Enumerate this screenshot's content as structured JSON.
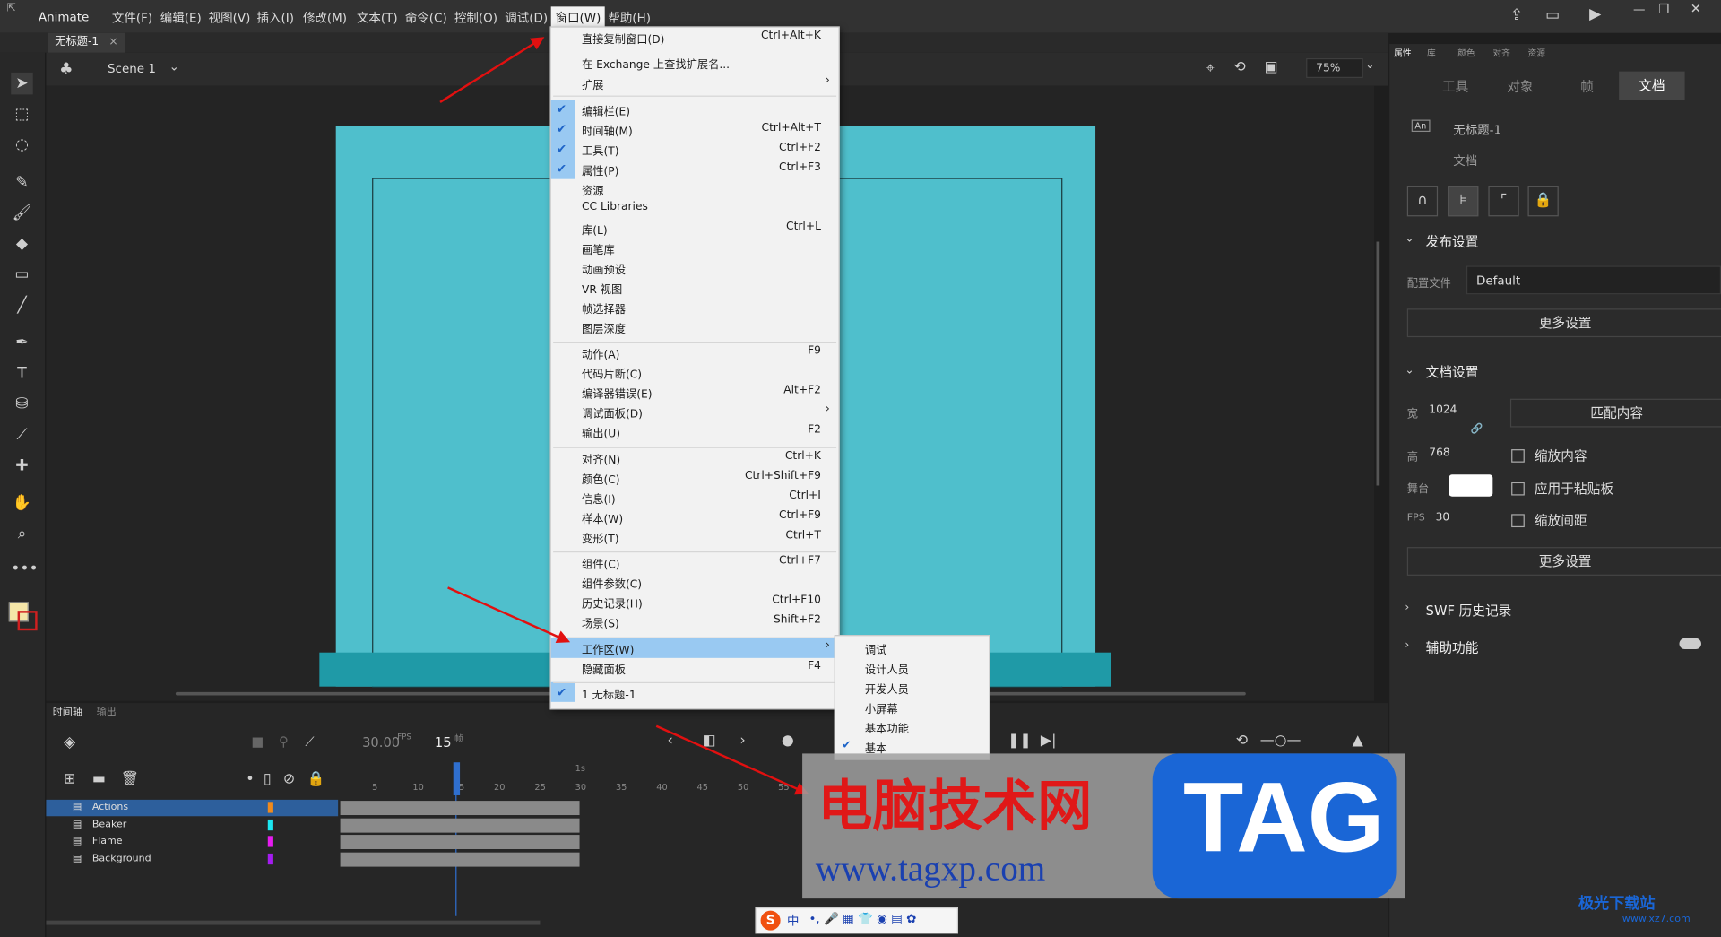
{
  "app": {
    "name": "Animate"
  },
  "menubar": {
    "items": [
      "文件(F)",
      "编辑(E)",
      "视图(V)",
      "插入(I)",
      "修改(M)",
      "文本(T)",
      "命令(C)",
      "控制(O)",
      "调试(D)",
      "窗口(W)",
      "帮助(H)"
    ]
  },
  "doc_tab": {
    "title": "无标题-1",
    "close": "×"
  },
  "scene": {
    "label": "Scene 1",
    "zoom": "75%"
  },
  "window_menu": {
    "items": [
      {
        "label": "直接复制窗口(D)",
        "shortcut": "Ctrl+Alt+K",
        "checked": false
      },
      {
        "label": "在 Exchange 上查找扩展名...",
        "shortcut": "",
        "checked": false
      },
      {
        "label": "扩展",
        "shortcut": "›",
        "checked": false
      },
      {
        "label": "编辑栏(E)",
        "shortcut": "",
        "checked": true
      },
      {
        "label": "时间轴(M)",
        "shortcut": "Ctrl+Alt+T",
        "checked": true
      },
      {
        "label": "工具(T)",
        "shortcut": "Ctrl+F2",
        "checked": true
      },
      {
        "label": "属性(P)",
        "shortcut": "Ctrl+F3",
        "checked": true
      },
      {
        "label": "资源",
        "shortcut": "",
        "checked": false
      },
      {
        "label": "CC Libraries",
        "shortcut": "",
        "checked": false
      },
      {
        "label": "库(L)",
        "shortcut": "Ctrl+L",
        "checked": false
      },
      {
        "label": "画笔库",
        "shortcut": "",
        "checked": false
      },
      {
        "label": "动画预设",
        "shortcut": "",
        "checked": false
      },
      {
        "label": "VR 视图",
        "shortcut": "",
        "checked": false
      },
      {
        "label": "帧选择器",
        "shortcut": "",
        "checked": false
      },
      {
        "label": "图层深度",
        "shortcut": "",
        "checked": false
      },
      {
        "label": "动作(A)",
        "shortcut": "F9",
        "checked": false
      },
      {
        "label": "代码片断(C)",
        "shortcut": "",
        "checked": false
      },
      {
        "label": "编译器错误(E)",
        "shortcut": "Alt+F2",
        "checked": false
      },
      {
        "label": "调试面板(D)",
        "shortcut": "›",
        "checked": false
      },
      {
        "label": "输出(U)",
        "shortcut": "F2",
        "checked": false
      },
      {
        "label": "对齐(N)",
        "shortcut": "Ctrl+K",
        "checked": false
      },
      {
        "label": "颜色(C)",
        "shortcut": "Ctrl+Shift+F9",
        "checked": false
      },
      {
        "label": "信息(I)",
        "shortcut": "Ctrl+I",
        "checked": false
      },
      {
        "label": "样本(W)",
        "shortcut": "Ctrl+F9",
        "checked": false
      },
      {
        "label": "变形(T)",
        "shortcut": "Ctrl+T",
        "checked": false
      },
      {
        "label": "组件(C)",
        "shortcut": "Ctrl+F7",
        "checked": false
      },
      {
        "label": "组件参数(C)",
        "shortcut": "",
        "checked": false
      },
      {
        "label": "历史记录(H)",
        "shortcut": "Ctrl+F10",
        "checked": false
      },
      {
        "label": "场景(S)",
        "shortcut": "Shift+F2",
        "checked": false
      },
      {
        "label": "工作区(W)",
        "shortcut": "›",
        "checked": false
      },
      {
        "label": "隐藏面板",
        "shortcut": "F4",
        "checked": false
      },
      {
        "label": "1 无标题-1",
        "shortcut": "",
        "checked": true
      }
    ]
  },
  "workspace_submenu": {
    "items": [
      {
        "label": "调试",
        "checked": false
      },
      {
        "label": "设计人员",
        "checked": false
      },
      {
        "label": "开发人员",
        "checked": false
      },
      {
        "label": "小屏幕",
        "checked": false
      },
      {
        "label": "基本功能",
        "checked": false
      },
      {
        "label": "基本",
        "checked": true
      }
    ]
  },
  "timeline": {
    "tabs": [
      "时间轴",
      "输出"
    ],
    "fps": "30.00",
    "fps_unit": "FPS",
    "frame": "15",
    "frame_unit": "帧",
    "ruler": [
      "5",
      "10",
      "15",
      "20",
      "25",
      "30",
      "35",
      "40",
      "45",
      "50",
      "55"
    ],
    "second_marker": "1s",
    "layers": [
      {
        "name": "Actions",
        "color": "#f08a1c"
      },
      {
        "name": "Beaker",
        "color": "#1ce6f0"
      },
      {
        "name": "Flame",
        "color": "#e61cf0"
      },
      {
        "name": "Background",
        "color": "#a51cf0"
      }
    ]
  },
  "properties": {
    "top_tabs": [
      "属性",
      "库",
      "颜色",
      "对齐",
      "资源"
    ],
    "sub_tabs": [
      "工具",
      "对象",
      "帧",
      "文档"
    ],
    "doc_name": "无标题-1",
    "doc_type": "文档",
    "publish_header": "发布设置",
    "profile_label": "配置文件",
    "profile_value": "Default",
    "more_settings": "更多设置",
    "doc_settings_header": "文档设置",
    "width_label": "宽",
    "width": "1024",
    "height_label": "高",
    "height": "768",
    "match_content": "匹配内容",
    "stage_label": "舞台",
    "stage_color": "#ffffff",
    "fps_label": "FPS",
    "fps": "30",
    "scale_content": "缩放内容",
    "apply_paste": "应用于粘贴板",
    "scale_spacing": "缩放间距",
    "more_settings2": "更多设置",
    "swf_history": "SWF 历史记录",
    "accessibility": "辅助功能"
  },
  "watermark": {
    "title": "电脑技术网",
    "url": "www.tagxp.com",
    "logo": "TAG"
  },
  "corner_watermark": {
    "site": "极光下载站",
    "url": "www.xz7.com"
  },
  "ime_bar": {
    "label": "中"
  },
  "colors": {
    "stage": "#4fbfcc",
    "accent": "#99c9f2",
    "arrow": "#e21010"
  }
}
